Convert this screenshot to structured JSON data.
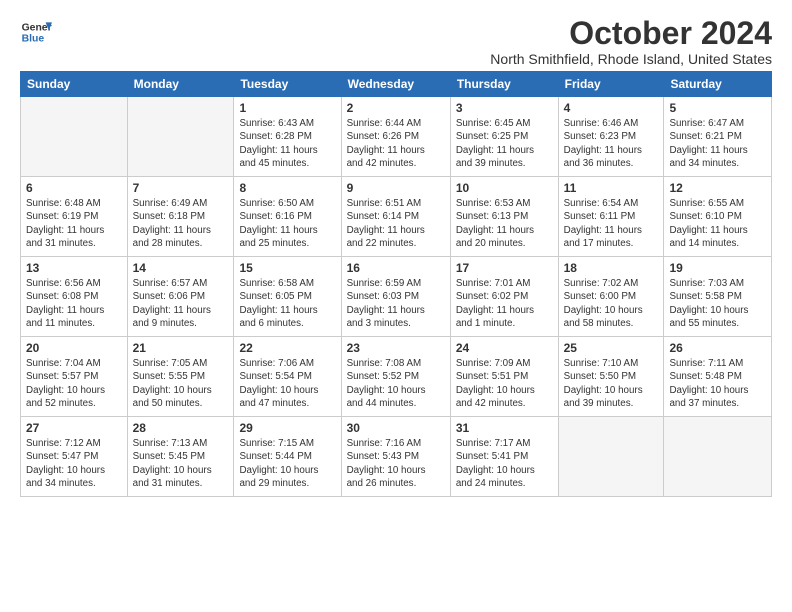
{
  "logo": {
    "line1": "General",
    "line2": "Blue"
  },
  "title": "October 2024",
  "location": "North Smithfield, Rhode Island, United States",
  "weekdays": [
    "Sunday",
    "Monday",
    "Tuesday",
    "Wednesday",
    "Thursday",
    "Friday",
    "Saturday"
  ],
  "weeks": [
    [
      {
        "day": "",
        "detail": ""
      },
      {
        "day": "",
        "detail": ""
      },
      {
        "day": "1",
        "detail": "Sunrise: 6:43 AM\nSunset: 6:28 PM\nDaylight: 11 hours\nand 45 minutes."
      },
      {
        "day": "2",
        "detail": "Sunrise: 6:44 AM\nSunset: 6:26 PM\nDaylight: 11 hours\nand 42 minutes."
      },
      {
        "day": "3",
        "detail": "Sunrise: 6:45 AM\nSunset: 6:25 PM\nDaylight: 11 hours\nand 39 minutes."
      },
      {
        "day": "4",
        "detail": "Sunrise: 6:46 AM\nSunset: 6:23 PM\nDaylight: 11 hours\nand 36 minutes."
      },
      {
        "day": "5",
        "detail": "Sunrise: 6:47 AM\nSunset: 6:21 PM\nDaylight: 11 hours\nand 34 minutes."
      }
    ],
    [
      {
        "day": "6",
        "detail": "Sunrise: 6:48 AM\nSunset: 6:19 PM\nDaylight: 11 hours\nand 31 minutes."
      },
      {
        "day": "7",
        "detail": "Sunrise: 6:49 AM\nSunset: 6:18 PM\nDaylight: 11 hours\nand 28 minutes."
      },
      {
        "day": "8",
        "detail": "Sunrise: 6:50 AM\nSunset: 6:16 PM\nDaylight: 11 hours\nand 25 minutes."
      },
      {
        "day": "9",
        "detail": "Sunrise: 6:51 AM\nSunset: 6:14 PM\nDaylight: 11 hours\nand 22 minutes."
      },
      {
        "day": "10",
        "detail": "Sunrise: 6:53 AM\nSunset: 6:13 PM\nDaylight: 11 hours\nand 20 minutes."
      },
      {
        "day": "11",
        "detail": "Sunrise: 6:54 AM\nSunset: 6:11 PM\nDaylight: 11 hours\nand 17 minutes."
      },
      {
        "day": "12",
        "detail": "Sunrise: 6:55 AM\nSunset: 6:10 PM\nDaylight: 11 hours\nand 14 minutes."
      }
    ],
    [
      {
        "day": "13",
        "detail": "Sunrise: 6:56 AM\nSunset: 6:08 PM\nDaylight: 11 hours\nand 11 minutes."
      },
      {
        "day": "14",
        "detail": "Sunrise: 6:57 AM\nSunset: 6:06 PM\nDaylight: 11 hours\nand 9 minutes."
      },
      {
        "day": "15",
        "detail": "Sunrise: 6:58 AM\nSunset: 6:05 PM\nDaylight: 11 hours\nand 6 minutes."
      },
      {
        "day": "16",
        "detail": "Sunrise: 6:59 AM\nSunset: 6:03 PM\nDaylight: 11 hours\nand 3 minutes."
      },
      {
        "day": "17",
        "detail": "Sunrise: 7:01 AM\nSunset: 6:02 PM\nDaylight: 11 hours\nand 1 minute."
      },
      {
        "day": "18",
        "detail": "Sunrise: 7:02 AM\nSunset: 6:00 PM\nDaylight: 10 hours\nand 58 minutes."
      },
      {
        "day": "19",
        "detail": "Sunrise: 7:03 AM\nSunset: 5:58 PM\nDaylight: 10 hours\nand 55 minutes."
      }
    ],
    [
      {
        "day": "20",
        "detail": "Sunrise: 7:04 AM\nSunset: 5:57 PM\nDaylight: 10 hours\nand 52 minutes."
      },
      {
        "day": "21",
        "detail": "Sunrise: 7:05 AM\nSunset: 5:55 PM\nDaylight: 10 hours\nand 50 minutes."
      },
      {
        "day": "22",
        "detail": "Sunrise: 7:06 AM\nSunset: 5:54 PM\nDaylight: 10 hours\nand 47 minutes."
      },
      {
        "day": "23",
        "detail": "Sunrise: 7:08 AM\nSunset: 5:52 PM\nDaylight: 10 hours\nand 44 minutes."
      },
      {
        "day": "24",
        "detail": "Sunrise: 7:09 AM\nSunset: 5:51 PM\nDaylight: 10 hours\nand 42 minutes."
      },
      {
        "day": "25",
        "detail": "Sunrise: 7:10 AM\nSunset: 5:50 PM\nDaylight: 10 hours\nand 39 minutes."
      },
      {
        "day": "26",
        "detail": "Sunrise: 7:11 AM\nSunset: 5:48 PM\nDaylight: 10 hours\nand 37 minutes."
      }
    ],
    [
      {
        "day": "27",
        "detail": "Sunrise: 7:12 AM\nSunset: 5:47 PM\nDaylight: 10 hours\nand 34 minutes."
      },
      {
        "day": "28",
        "detail": "Sunrise: 7:13 AM\nSunset: 5:45 PM\nDaylight: 10 hours\nand 31 minutes."
      },
      {
        "day": "29",
        "detail": "Sunrise: 7:15 AM\nSunset: 5:44 PM\nDaylight: 10 hours\nand 29 minutes."
      },
      {
        "day": "30",
        "detail": "Sunrise: 7:16 AM\nSunset: 5:43 PM\nDaylight: 10 hours\nand 26 minutes."
      },
      {
        "day": "31",
        "detail": "Sunrise: 7:17 AM\nSunset: 5:41 PM\nDaylight: 10 hours\nand 24 minutes."
      },
      {
        "day": "",
        "detail": ""
      },
      {
        "day": "",
        "detail": ""
      }
    ]
  ]
}
